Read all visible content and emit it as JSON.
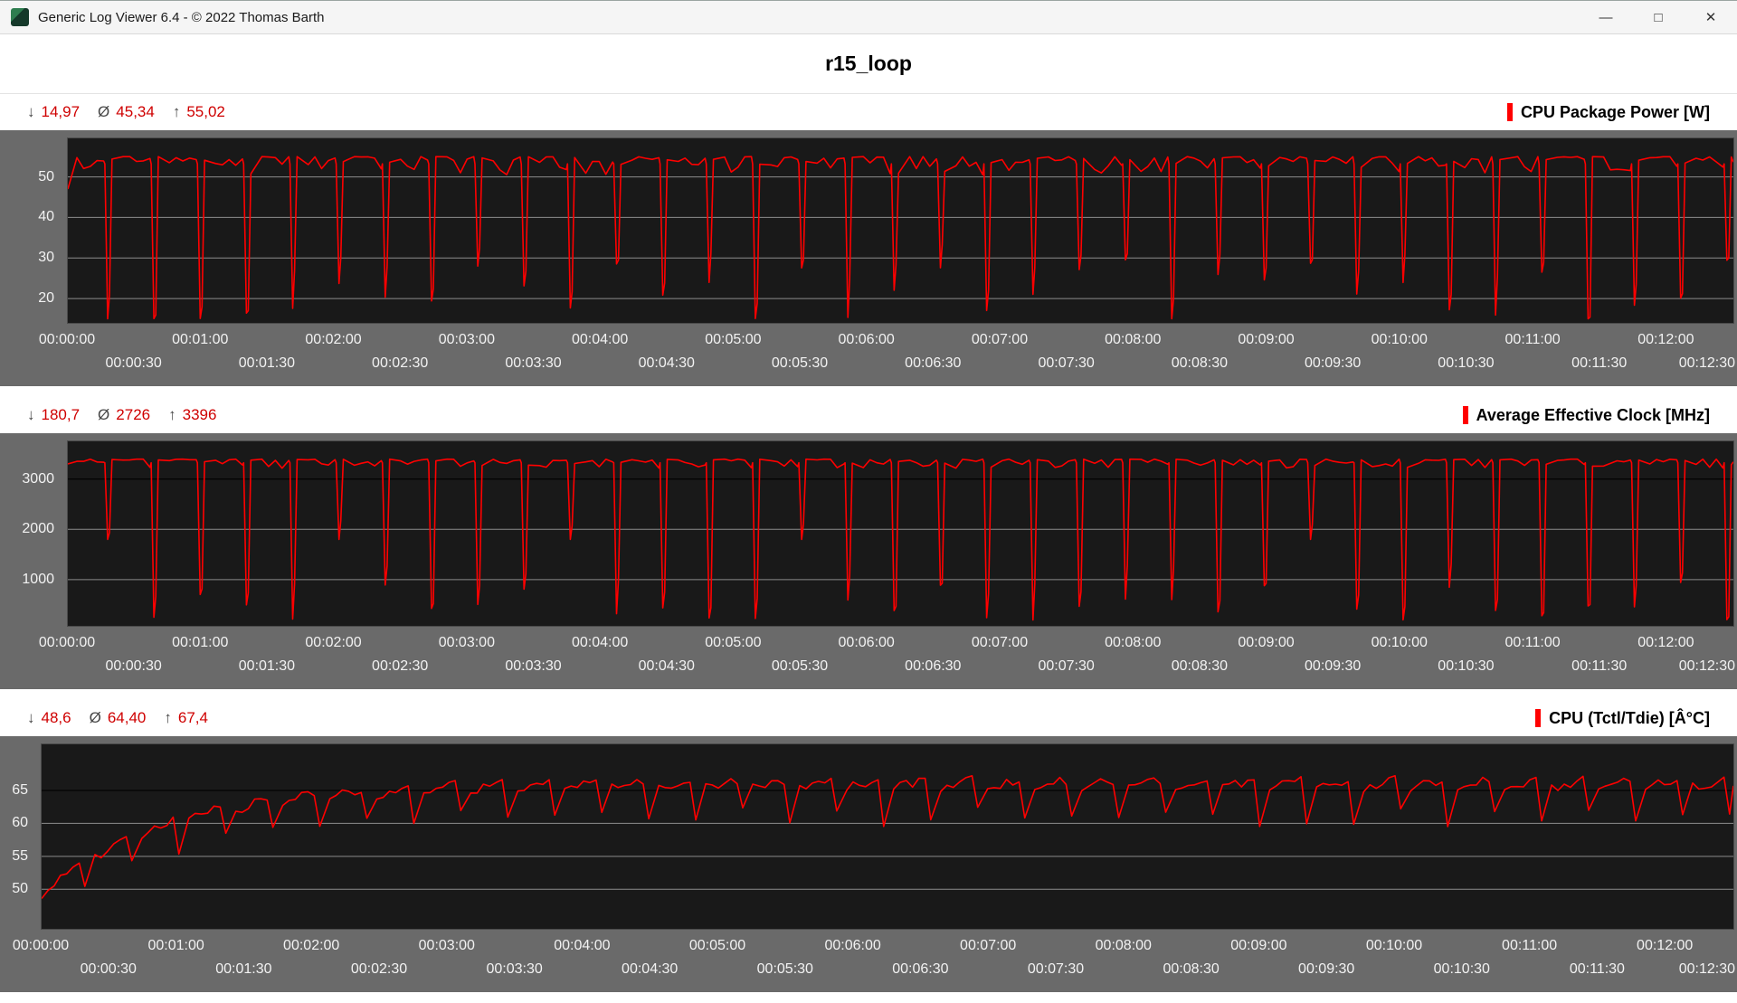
{
  "window": {
    "title": "Generic Log Viewer 6.4 - © 2022 Thomas Barth",
    "controls": {
      "minimize": "—",
      "maximize": "□",
      "close": "✕"
    }
  },
  "header": {
    "title": "r15_loop"
  },
  "stats_symbols": {
    "min": "↓",
    "avg": "Ø",
    "max": "↑"
  },
  "time_axis": {
    "major": [
      "00:00:00",
      "00:01:00",
      "00:02:00",
      "00:03:00",
      "00:04:00",
      "00:05:00",
      "00:06:00",
      "00:07:00",
      "00:08:00",
      "00:09:00",
      "00:10:00",
      "00:11:00",
      "00:12:00"
    ],
    "major_t": [
      0,
      60,
      120,
      180,
      240,
      300,
      360,
      420,
      480,
      540,
      600,
      660,
      720
    ],
    "minor": [
      "00:00:30",
      "00:01:30",
      "00:02:30",
      "00:03:30",
      "00:04:30",
      "00:05:30",
      "00:06:30",
      "00:07:30",
      "00:08:30",
      "00:09:30",
      "00:10:30",
      "00:11:30",
      "00:12:30"
    ],
    "minor_t": [
      30,
      90,
      150,
      210,
      270,
      330,
      390,
      450,
      510,
      570,
      630,
      690,
      750
    ]
  },
  "chart_data": [
    {
      "type": "line",
      "title": "CPU Package Power [W]",
      "unit": "W",
      "stats": {
        "min": "14,97",
        "avg": "45,34",
        "max": "55,02"
      },
      "stats_numeric": {
        "min": 14.97,
        "avg": 45.34,
        "max": 55.02
      },
      "line_color": "#ff0000",
      "grid": "on",
      "legend_position": "top-right",
      "y_ticks": [
        50,
        40,
        30,
        20
      ],
      "y_range": [
        14,
        59.5
      ],
      "x_range_s": [
        0,
        750
      ],
      "dark_grid": [],
      "waveform": {
        "kind": "loop",
        "cycles": 36,
        "t_end": 750,
        "start": 47,
        "high": 55.0,
        "jitter": 4.5,
        "plateau_skew": 2.2,
        "dip_min": 15.0,
        "dip_max": 31.0,
        "dip_skew": 2.0,
        "shallow_chance": 0,
        "shallow_value": 33,
        "seed": 3
      }
    },
    {
      "type": "line",
      "title": "Average Effective Clock [MHz]",
      "unit": "MHz",
      "stats": {
        "min": "180,7",
        "avg": "2726",
        "max": "3396"
      },
      "stats_numeric": {
        "min": 180.7,
        "avg": 2726,
        "max": 3396
      },
      "line_color": "#ff0000",
      "grid": "on",
      "legend_position": "top-right",
      "y_ticks": [
        3000,
        2000,
        1000
      ],
      "y_range": [
        80,
        3750
      ],
      "x_range_s": [
        0,
        750
      ],
      "dark_grid": [
        3000
      ],
      "waveform": {
        "kind": "loop",
        "cycles": 36,
        "t_end": 750,
        "start": 3300,
        "high": 3396,
        "jitter": 180,
        "plateau_skew": 2.2,
        "dip_min": 185,
        "dip_max": 950,
        "dip_skew": 1.6,
        "shallow_chance": 0.94,
        "shallow_value": 1800,
        "seed": 7
      }
    },
    {
      "type": "line",
      "title": "CPU (Tctl/Tdie) [Â°C]",
      "unit": "°C",
      "stats": {
        "min": "48,6",
        "avg": "64,40",
        "max": "67,4"
      },
      "stats_numeric": {
        "min": 48.6,
        "avg": 64.4,
        "max": 67.4
      },
      "line_color": "#ff0000",
      "grid": "on",
      "legend_position": "top-right",
      "y_ticks": [
        65,
        60,
        55,
        50
      ],
      "y_range": [
        44,
        72
      ],
      "x_range_s": [
        0,
        750
      ],
      "dark_grid": [
        65
      ],
      "waveform": {
        "kind": "temp",
        "cycles": 36,
        "t_end": 750,
        "ramp_from": 48.6,
        "ramp_to": 65.2,
        "ramp_tau": 55,
        "cycle_rise": 1.4,
        "wiggle": 0.7,
        "dip_depth": 4.2,
        "dip_var": 1.6,
        "max": 67.4,
        "seed": 11
      }
    }
  ]
}
